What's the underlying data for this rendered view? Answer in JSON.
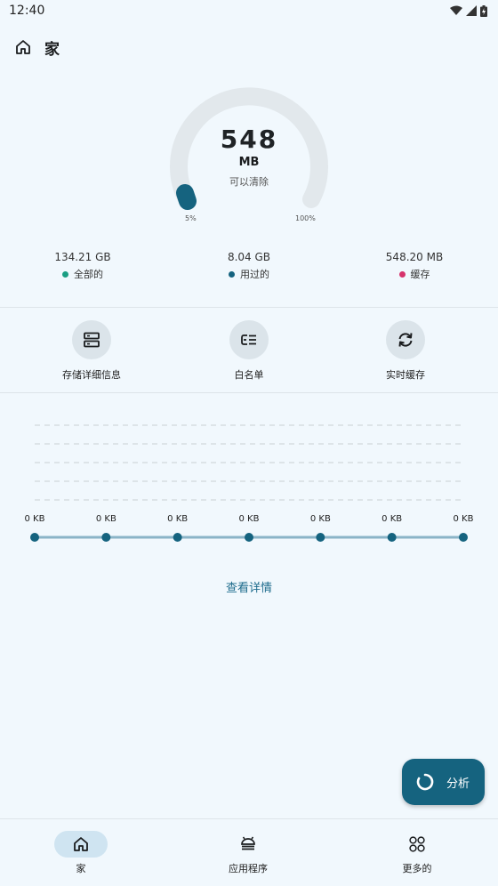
{
  "status_bar": {
    "time": "12:40"
  },
  "header": {
    "title": "家"
  },
  "gauge": {
    "value": "548",
    "unit": "MB",
    "subtitle": "可以清除",
    "min_label": "5%",
    "max_label": "100%",
    "level_percent": 5
  },
  "stats": [
    {
      "value": "134.21 GB",
      "label": "全部的",
      "color": "#1a9e83"
    },
    {
      "value": "8.04 GB",
      "label": "用过的",
      "color": "#15637f"
    },
    {
      "value": "548.20 MB",
      "label": "缓存",
      "color": "#d6336c"
    }
  ],
  "actions": [
    {
      "label": "存储详细信息",
      "icon": "storage-icon"
    },
    {
      "label": "白名单",
      "icon": "whitelist-icon"
    },
    {
      "label": "实时缓存",
      "icon": "sync-icon"
    }
  ],
  "chart_data": {
    "type": "line",
    "x": [
      1,
      2,
      3,
      4,
      5,
      6,
      7
    ],
    "values": [
      0,
      0,
      0,
      0,
      0,
      0,
      0
    ],
    "data_labels": [
      "0 KB",
      "0 KB",
      "0 KB",
      "0 KB",
      "0 KB",
      "0 KB",
      "0 KB"
    ],
    "grid": true,
    "color": "#15637f"
  },
  "link": {
    "label": "查看详情"
  },
  "fab": {
    "label": "分析",
    "icon": "progress-ring-icon"
  },
  "bottom_nav": [
    {
      "label": "家",
      "icon": "home-icon",
      "active": true
    },
    {
      "label": "应用程序",
      "icon": "android-icon",
      "active": false
    },
    {
      "label": "更多的",
      "icon": "grid-dots-icon",
      "active": false
    }
  ]
}
